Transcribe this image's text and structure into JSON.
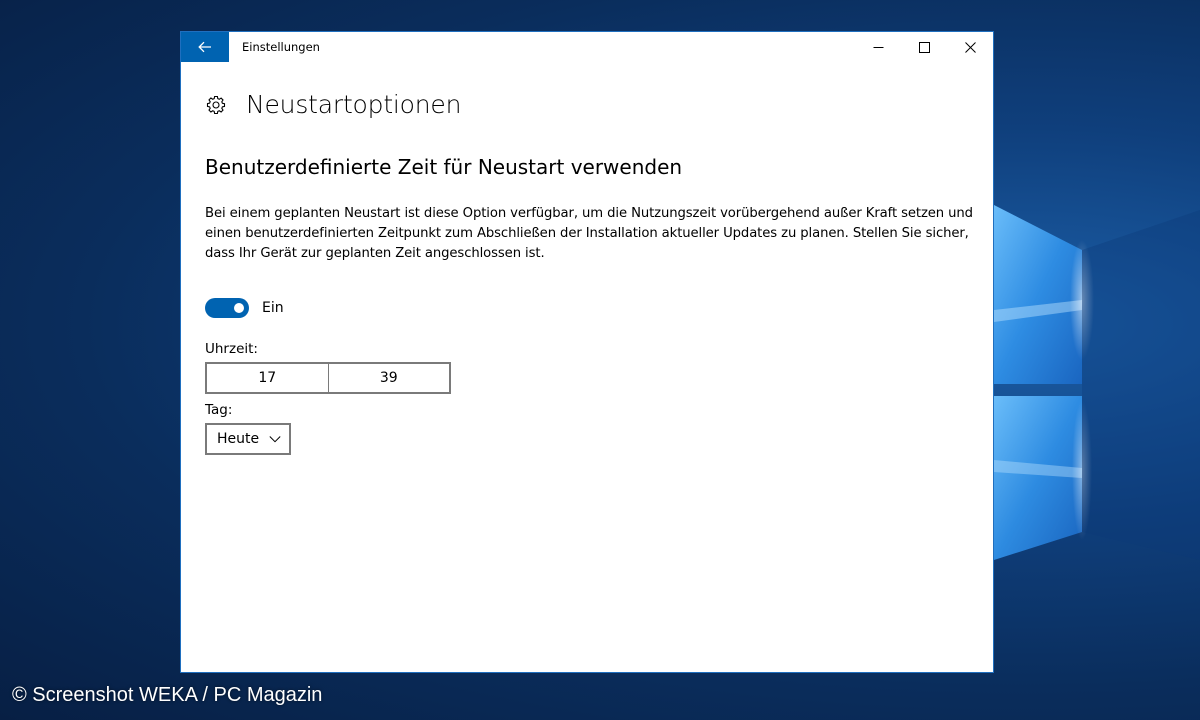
{
  "watermark": {
    "text": "© Screenshot WEKA / PC Magazin"
  },
  "window": {
    "title": "Einstellungen",
    "controls": {
      "back_icon": "arrow-left-icon",
      "minimize_icon": "minimize-icon",
      "maximize_icon": "maximize-icon",
      "close_icon": "close-icon"
    },
    "accent_color": "#0063b1"
  },
  "page": {
    "header_icon": "gear-icon",
    "title": "Neustartoptionen",
    "section_title": "Benutzerdefinierte Zeit für Neustart verwenden",
    "description": "Bei einem geplanten Neustart ist diese Option verfügbar, um die Nutzungszeit vorübergehend außer Kraft setzen und einen benutzerdefinierten Zeitpunkt zum Abschließen der Installation aktueller Updates zu planen. Stellen Sie sicher, dass Ihr Gerät zur geplanten Zeit angeschlossen ist.",
    "toggle": {
      "state": "on",
      "label": "Ein"
    },
    "time": {
      "label": "Uhrzeit:",
      "hour": "17",
      "minute": "39"
    },
    "day": {
      "label": "Tag:",
      "selected": "Heute",
      "dropdown_icon": "chevron-down-icon"
    }
  }
}
